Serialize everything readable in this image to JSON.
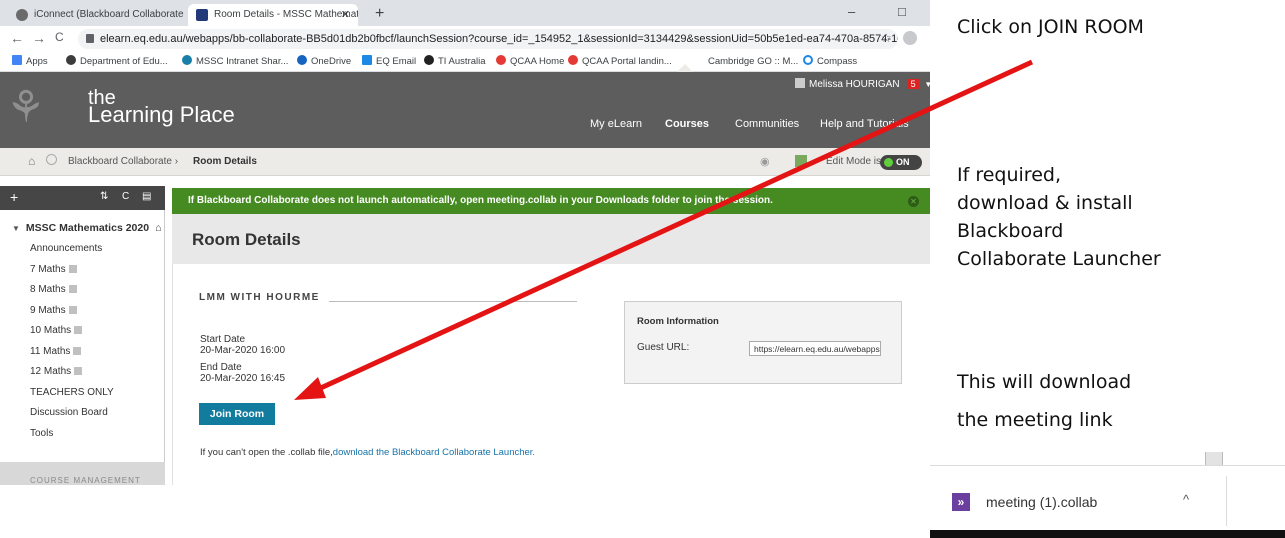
{
  "browser": {
    "tabs": [
      {
        "label": "iConnect (Blackboard Collaborate",
        "close": "✕"
      },
      {
        "label": "Room Details - MSSC Mathemati",
        "close": "✕"
      }
    ],
    "new_tab": "+",
    "minimize": "–",
    "restore": "□",
    "back": "←",
    "forward": "→",
    "reload": "C",
    "url": "elearn.eq.edu.au/webapps/bb-collaborate-BB5d01db2b0fbcf/launchSession?course_id=_154952_1&sessionId=3134429&sessionUid=50b5e1ed-ea74-470a-8574-10...",
    "star": "☆",
    "bookmarks": [
      {
        "label": "Apps",
        "color": "#4285f4"
      },
      {
        "label": "Department of Edu...",
        "color": "#3c3c3c"
      },
      {
        "label": "MSSC Intranet Shar...",
        "color": "#1a7fa8"
      },
      {
        "label": "OneDrive",
        "color": "#1565c0"
      },
      {
        "label": "EQ Email",
        "color": "#1e88e5"
      },
      {
        "label": "TI Australia",
        "color": "#222222"
      },
      {
        "label": "QCAA Home",
        "color": "#e53935"
      },
      {
        "label": "QCAA Portal landin...",
        "color": "#e53935"
      },
      {
        "label": "Cambridge GO :: M...",
        "color": "#ffffff"
      },
      {
        "label": "Compass",
        "color": "#1e88e5"
      }
    ]
  },
  "site": {
    "brand_small": "the",
    "brand_big": "earning Place",
    "brand_l": "L",
    "user_name": "Melissa HOURIGAN",
    "user_badge": "5",
    "user_caret": "▼",
    "nav": [
      "My eLearn",
      "Courses",
      "Communities",
      "Help and Tutorials"
    ],
    "active_nav": "Courses",
    "tree_glyph": "⚘"
  },
  "breadcrumb": {
    "home_icon": "⌂",
    "link": "Blackboard Collaborate",
    "separator": "›",
    "current": "Room Details",
    "edit_mode_label": "Edit Mode is:",
    "edit_mode_value": "ON"
  },
  "sidebar": {
    "add": "+",
    "controls": [
      "⇅",
      "C",
      "▤"
    ],
    "course_title": "MSSC Mathematics 2020",
    "home_icon": "⌂",
    "items": [
      {
        "label": "Announcements",
        "square": false
      },
      {
        "label": "7 Maths",
        "square": true
      },
      {
        "label": "8 Maths",
        "square": true
      },
      {
        "label": "9 Maths",
        "square": true
      },
      {
        "label": "10 Maths",
        "square": true
      },
      {
        "label": "11 Maths",
        "square": true
      },
      {
        "label": "12 Maths",
        "square": true
      },
      {
        "label": "TEACHERS ONLY",
        "square": false
      },
      {
        "label": "Discussion Board",
        "square": false
      },
      {
        "label": "Tools",
        "square": false
      }
    ],
    "management_label": "COURSE MANAGEMENT"
  },
  "notice": {
    "text": "If Blackboard Collaborate does not launch automatically, open meeting.collab in your Downloads folder to join the session.",
    "close": "✕"
  },
  "room": {
    "page_title": "Room Details",
    "name": "LMM WITH HOURME",
    "start_label": "Start Date",
    "start_value": "20-Mar-2020 16:00",
    "end_label": "End Date",
    "end_value": "20-Mar-2020 16:45",
    "join_button": "Join Room",
    "note_prefix": "If you can't open the .collab file,",
    "note_link": "download the Blackboard Collaborate Launcher.",
    "info_title": "Room Information",
    "guest_url_label": "Guest URL:",
    "guest_url_value": "https://elearn.eq.edu.au/webapps"
  },
  "annotations": {
    "click": "Click on JOIN ROOM",
    "required_lines": [
      "If required,",
      "download & install",
      "Blackboard",
      "Collaborate Launcher"
    ],
    "download_lines": [
      "This will download",
      "the meeting link"
    ],
    "arrow_color": "#e41414"
  },
  "download_bar": {
    "file_name": "meeting (1).collab",
    "file_icon": "»",
    "caret": "^"
  }
}
